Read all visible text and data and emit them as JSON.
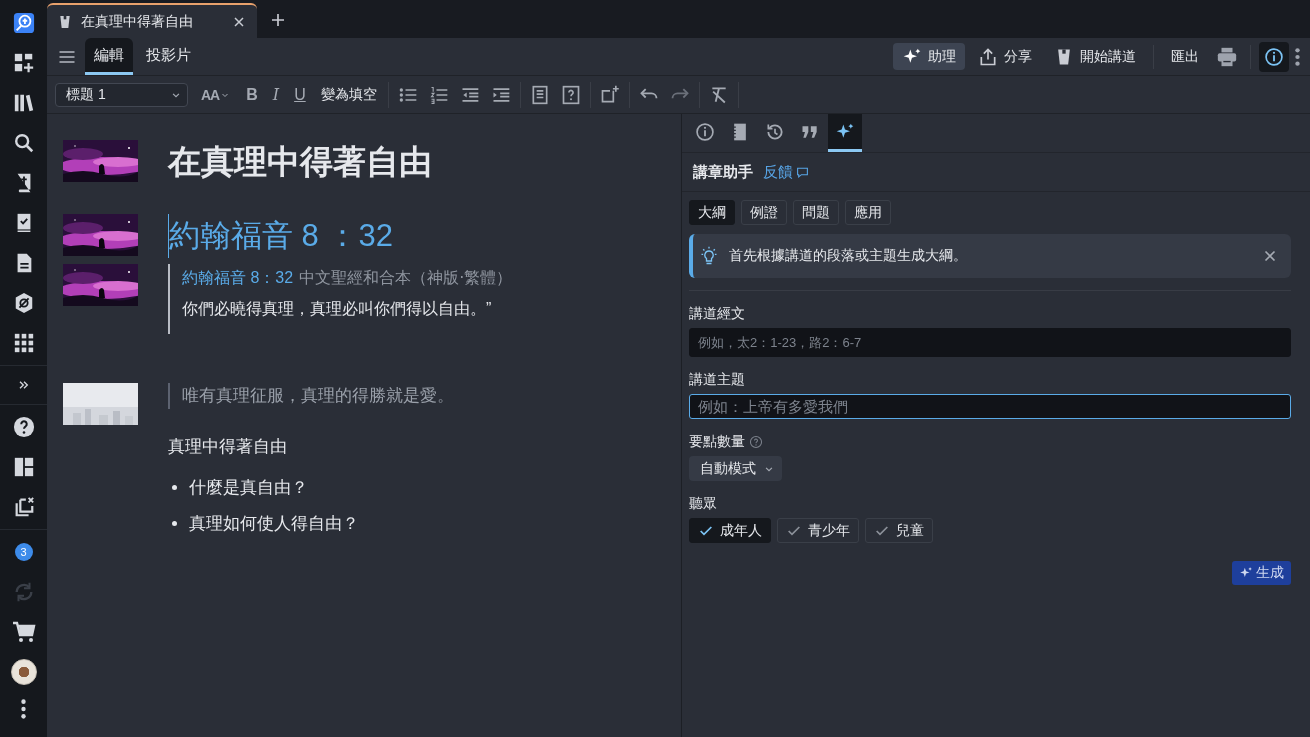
{
  "document_tab": {
    "title": "在真理中得著自由"
  },
  "rail": {
    "badge": "3"
  },
  "mode_tabs": [
    {
      "label": "編輯",
      "selected": true
    },
    {
      "label": "投影片",
      "selected": false
    }
  ],
  "actions": [
    {
      "label": "助理",
      "selected": true
    },
    {
      "label": "分享",
      "selected": false
    },
    {
      "label": "開始講道",
      "selected": false
    },
    {
      "label": "匯出",
      "selected": false
    }
  ],
  "format_toolbar": {
    "style": "標題 1",
    "font_size": "AA",
    "bold": "B",
    "italic": "I",
    "underline": "U",
    "cloze": "變為填空"
  },
  "document": {
    "title": "在真理中得著自由",
    "blocks": [
      {
        "kind": "heading",
        "text": "約翰福音 8 ：32"
      },
      {
        "kind": "scripture",
        "reference": "約翰福音 8：32",
        "version": "中文聖經和合本（神版‧繁體）",
        "text": "你們必曉得真理，真理必叫你們得以自由。”"
      },
      {
        "kind": "quote",
        "text": "唯有真理征服，真理的得勝就是愛。"
      },
      {
        "kind": "subheading",
        "text": "真理中得著自由"
      },
      {
        "kind": "bullets",
        "items": [
          "什麼是真自由？",
          "真理如何使人得自由？"
        ]
      }
    ]
  },
  "panel_tabs": [
    {
      "selected": false
    },
    {
      "selected": false
    },
    {
      "selected": false
    },
    {
      "selected": false
    },
    {
      "selected": true
    }
  ],
  "assistant": {
    "title": "講章助手",
    "feedback": "反饋",
    "tabs": [
      {
        "label": "大綱",
        "selected": true
      },
      {
        "label": "例證",
        "selected": false
      },
      {
        "label": "問題",
        "selected": false
      },
      {
        "label": "應用",
        "selected": false
      }
    ],
    "tip": "首先根據講道的段落或主題生成大綱。",
    "passage": {
      "label": "講道經文",
      "placeholder": "例如，太2：1-23，路2：6-7",
      "focused": false
    },
    "theme": {
      "label": "講道主題",
      "placeholder": "例如：上帝有多愛我們",
      "focused": true
    },
    "points": {
      "label": "要點數量",
      "value": "自動模式"
    },
    "audience": {
      "label": "聽眾",
      "options": [
        {
          "label": "成年人",
          "checked": true
        },
        {
          "label": "青少年",
          "checked": false
        },
        {
          "label": "兒童",
          "checked": false
        }
      ]
    },
    "generate": "生成"
  }
}
